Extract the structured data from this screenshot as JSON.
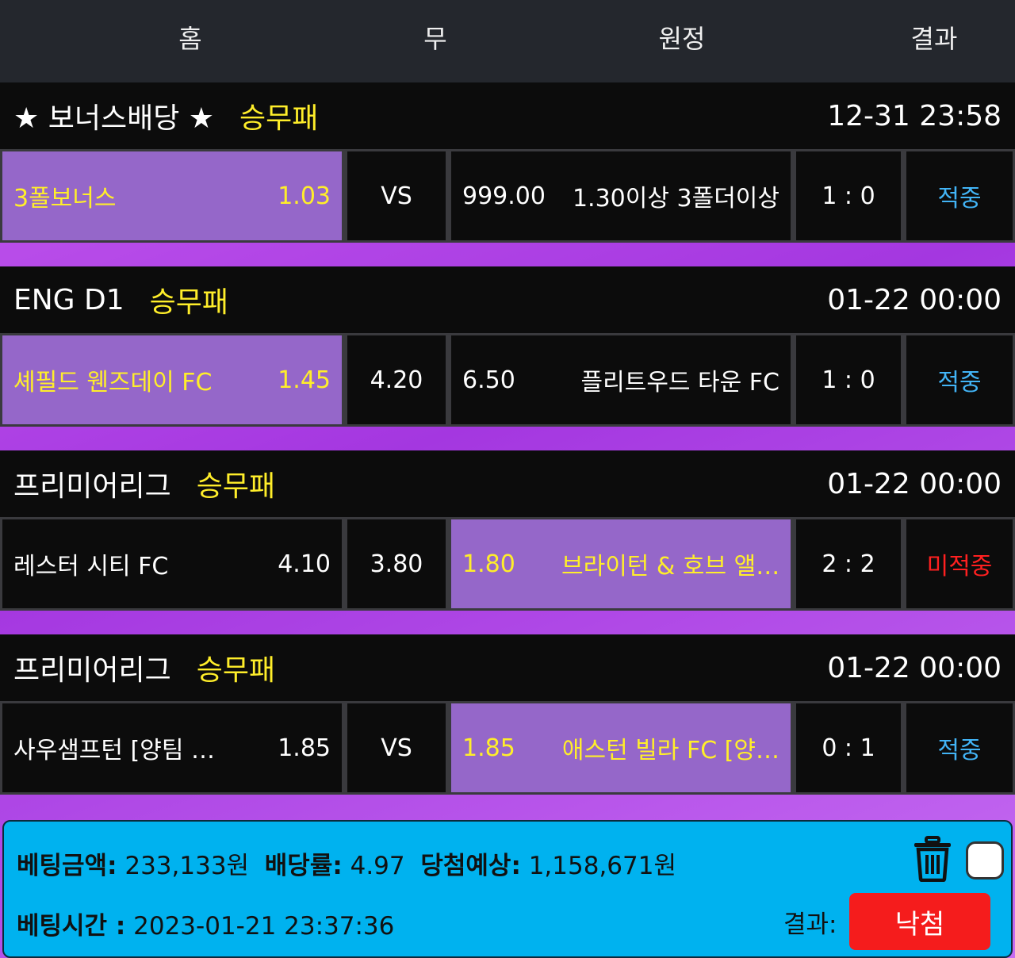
{
  "header": {
    "home": "홈",
    "draw": "무",
    "away": "원정",
    "result": "결과"
  },
  "games": [
    {
      "league": "★ 보너스배당 ★",
      "market": "승무패",
      "time": "12-31 23:58",
      "home": "3폴보너스",
      "home_odds": "1.03",
      "draw": "VS",
      "away_odds": "999.00",
      "away": "1.30이상 3폴더이상",
      "score": "1 : 0",
      "result": "적중",
      "selected": "home"
    },
    {
      "league": "ENG D1",
      "market": "승무패",
      "time": "01-22 00:00",
      "home": "셰필드 웬즈데이 FC",
      "home_odds": "1.45",
      "draw": "4.20",
      "away_odds": "6.50",
      "away": "플리트우드 타운 FC",
      "score": "1 : 0",
      "result": "적중",
      "selected": "home"
    },
    {
      "league": "프리미어리그",
      "market": "승무패",
      "time": "01-22 00:00",
      "home": "레스터 시티 FC",
      "home_odds": "4.10",
      "draw": "3.80",
      "away_odds": "1.80",
      "away": "브라이턴 & 호브 앨…",
      "score": "2 : 2",
      "result": "미적중",
      "selected": "away"
    },
    {
      "league": "프리미어리그",
      "market": "승무패",
      "time": "01-22 00:00",
      "home": "사우샘프턴 [양팀 …",
      "home_odds": "1.85",
      "draw": "VS",
      "away_odds": "1.85",
      "away": "애스턴 빌라 FC [양…",
      "score": "0 : 1",
      "result": "적중",
      "selected": "away"
    }
  ],
  "footer": {
    "bet_amount_label": "베팅금액:",
    "bet_amount": "233,133원",
    "odds_label": "배당률:",
    "odds": "4.97",
    "expected_label": "당첨예상:",
    "expected": "1,158,671원",
    "bet_time_label": "베팅시간 :",
    "bet_time": "2023-01-21 23:37:36",
    "result_label": "결과:",
    "result_button": "낙첨"
  },
  "icons": {
    "delete": "trash-icon",
    "select": "checkbox"
  },
  "colors": {
    "selected": "#9567c9",
    "market": "#ffee2a",
    "win": "#42b4f6",
    "lose": "#ff2020",
    "footer": "#00b2ef",
    "result_button": "#f51c1c"
  }
}
